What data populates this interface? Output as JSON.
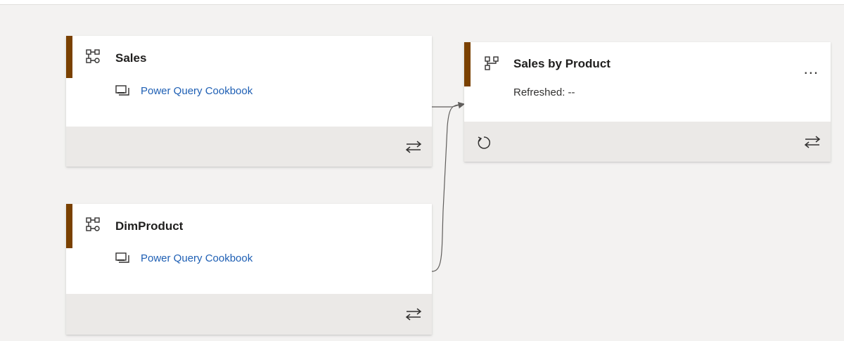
{
  "cards": {
    "sales": {
      "title": "Sales",
      "type_icon": "query-tree-icon",
      "source": "Power Query Cookbook",
      "source_icon": "dataset-icon",
      "footer_action_icon": "swap-arrows-icon"
    },
    "dimproduct": {
      "title": "DimProduct",
      "type_icon": "query-tree-icon",
      "source": "Power Query Cookbook",
      "source_icon": "dataset-icon",
      "footer_action_icon": "swap-arrows-icon"
    },
    "sales_by_product": {
      "title": "Sales by Product",
      "type_icon": "dataflow-icon",
      "status": "Refreshed: --",
      "more_label": "...",
      "refresh_icon": "refresh-icon",
      "footer_action_icon": "swap-arrows-icon"
    }
  },
  "colors": {
    "accent": "#7a4100",
    "link": "#1e5fb4",
    "canvas": "#f3f2f1",
    "card_footer": "#ebe9e7"
  }
}
